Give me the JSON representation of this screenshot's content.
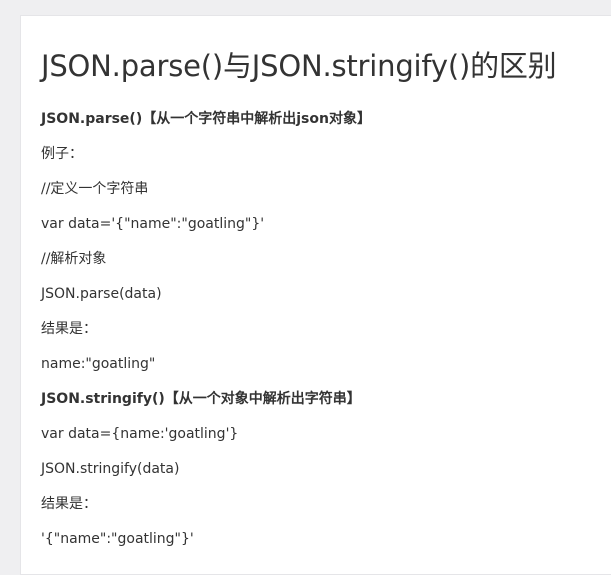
{
  "article": {
    "title": "JSON.parse()与JSON.stringify()的区别",
    "lines": [
      "JSON.parse()【从一个字符串中解析出json对象】",
      "例子：",
      "//定义一个字符串",
      "var data='{\"name\":\"goatling\"}'",
      "//解析对象",
      "JSON.parse(data)",
      "结果是：",
      "name:\"goatling\"",
      "JSON.stringify()【从一个对象中解析出字符串】",
      "var data={name:'goatling'}",
      "JSON.stringify(data)",
      "结果是：",
      "'{\"name\":\"goatling\"}'"
    ]
  }
}
